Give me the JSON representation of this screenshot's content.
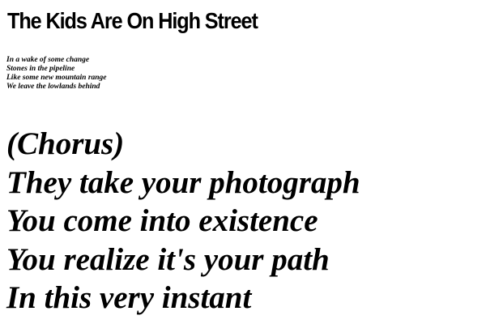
{
  "song": {
    "title": "The Kids Are On High Street"
  },
  "verse": {
    "lines": [
      "In a wake of some change",
      "Stones in the pipeline",
      "Like some new mountain range",
      "We leave the lowlands behind"
    ]
  },
  "chorus": {
    "lines": [
      "(Chorus)",
      "They take your photograph",
      "You come into existence",
      "You realize it's your path",
      "In this very instant"
    ]
  }
}
